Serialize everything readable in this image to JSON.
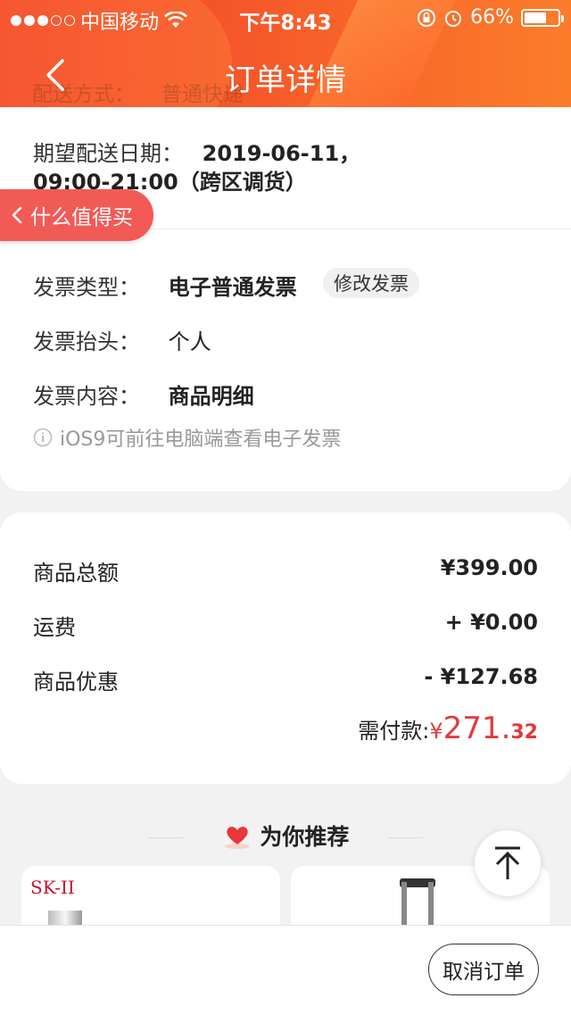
{
  "status_bar": {
    "carrier": "中国移动",
    "time": "下午8:43",
    "battery": "66%",
    "battery_level": 0.66
  },
  "header": {
    "title": "订单详情",
    "ghost_label": "配送方式：",
    "ghost_value": "普通快递"
  },
  "delivery": {
    "label": "期望配送日期：",
    "value_line1": "2019-06-11，",
    "value_line2": "09:00-21:00（跨区调货）"
  },
  "smzdm": {
    "label": "什么值得买"
  },
  "invoice": {
    "type_label": "发票类型：",
    "type_value": "电子普通发票",
    "modify_label": "修改发票",
    "title_label": "发票抬头：",
    "title_value": "个人",
    "content_label": "发票内容：",
    "content_value": "商品明细",
    "tip": "iOS9可前往电脑端查看电子发票"
  },
  "amounts": {
    "rows": [
      {
        "label": "商品总额",
        "value": "¥399.00"
      },
      {
        "label": "运费",
        "value": "+ ¥0.00"
      },
      {
        "label": "商品优惠",
        "value": "- ¥127.68"
      }
    ],
    "pay_label": "需付款:",
    "pay_currency": "¥",
    "pay_int": "271.",
    "pay_dec": "32"
  },
  "recommend": {
    "title": "为你推荐",
    "brand": "SK-II"
  },
  "bottom": {
    "cancel_label": "取消订单"
  }
}
